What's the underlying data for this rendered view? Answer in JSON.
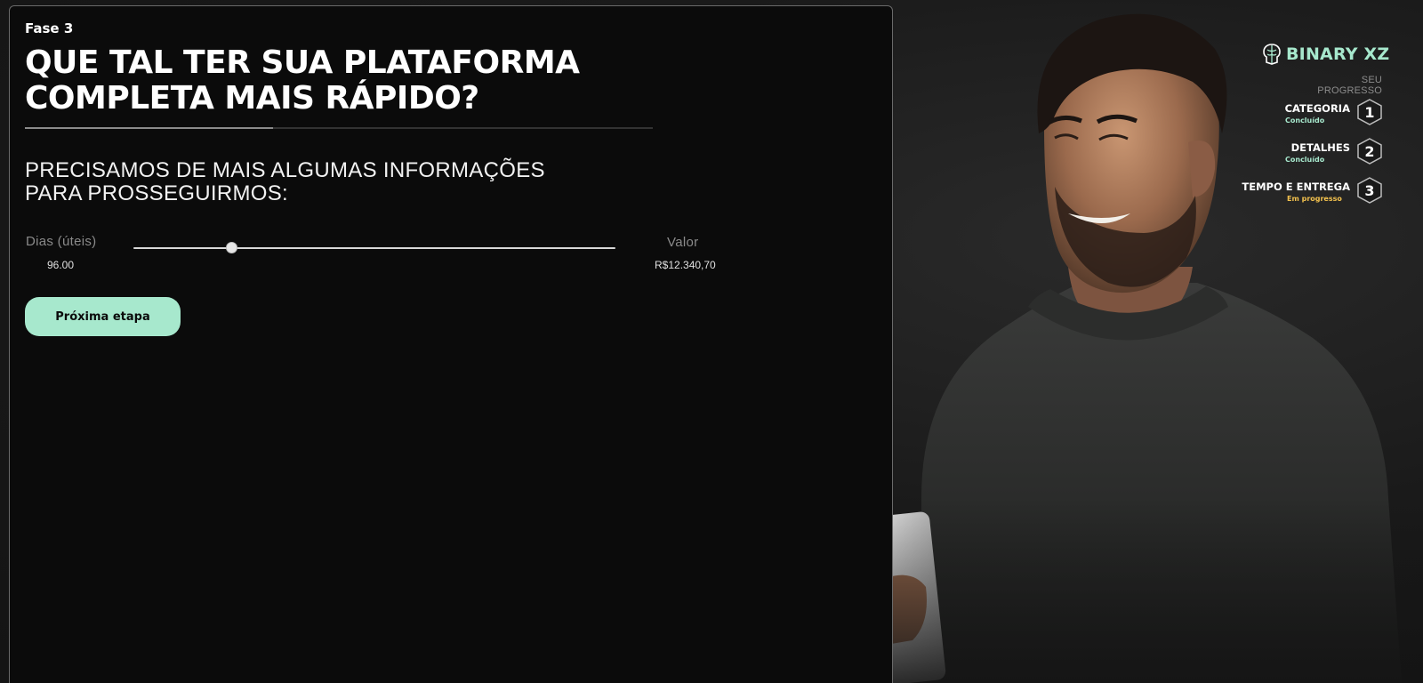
{
  "form": {
    "phase": "Fase 3",
    "title_line1": "QUE TAL TER SUA PLATAFORMA",
    "title_line2": "COMPLETA MAIS RÁPIDO?",
    "subtitle_line1": "PRECISAMOS DE MAIS ALGUMAS INFORMAÇÕES",
    "subtitle_line2": "PARA PROSSEGUIRMOS:",
    "days_label": "Dias (úteis)",
    "days_value": "96.00",
    "slider_position": 0.205,
    "value_label": "Valor",
    "value_amount": "R$12.340,70",
    "next_button": "Próxima etapa",
    "accent_color": "#a7e8cd"
  },
  "sidebar": {
    "brand": "BINARY XZ",
    "progress_caption": "SEU PROGRESSO",
    "steps": [
      {
        "label": "CATEGORIA",
        "status": "Concluído",
        "number": "1",
        "status_color": "#a7e8cd"
      },
      {
        "label": "DETALHES",
        "status": "Concluído",
        "number": "2",
        "status_color": "#a7e8cd"
      },
      {
        "label": "TEMPO E ENTREGA",
        "status": "Em progresso",
        "number": "3",
        "status_color": "#f2c14e"
      }
    ]
  },
  "icons": {
    "brand_logo": "brain-logo-icon",
    "step_badge": "hexagon-icon"
  }
}
